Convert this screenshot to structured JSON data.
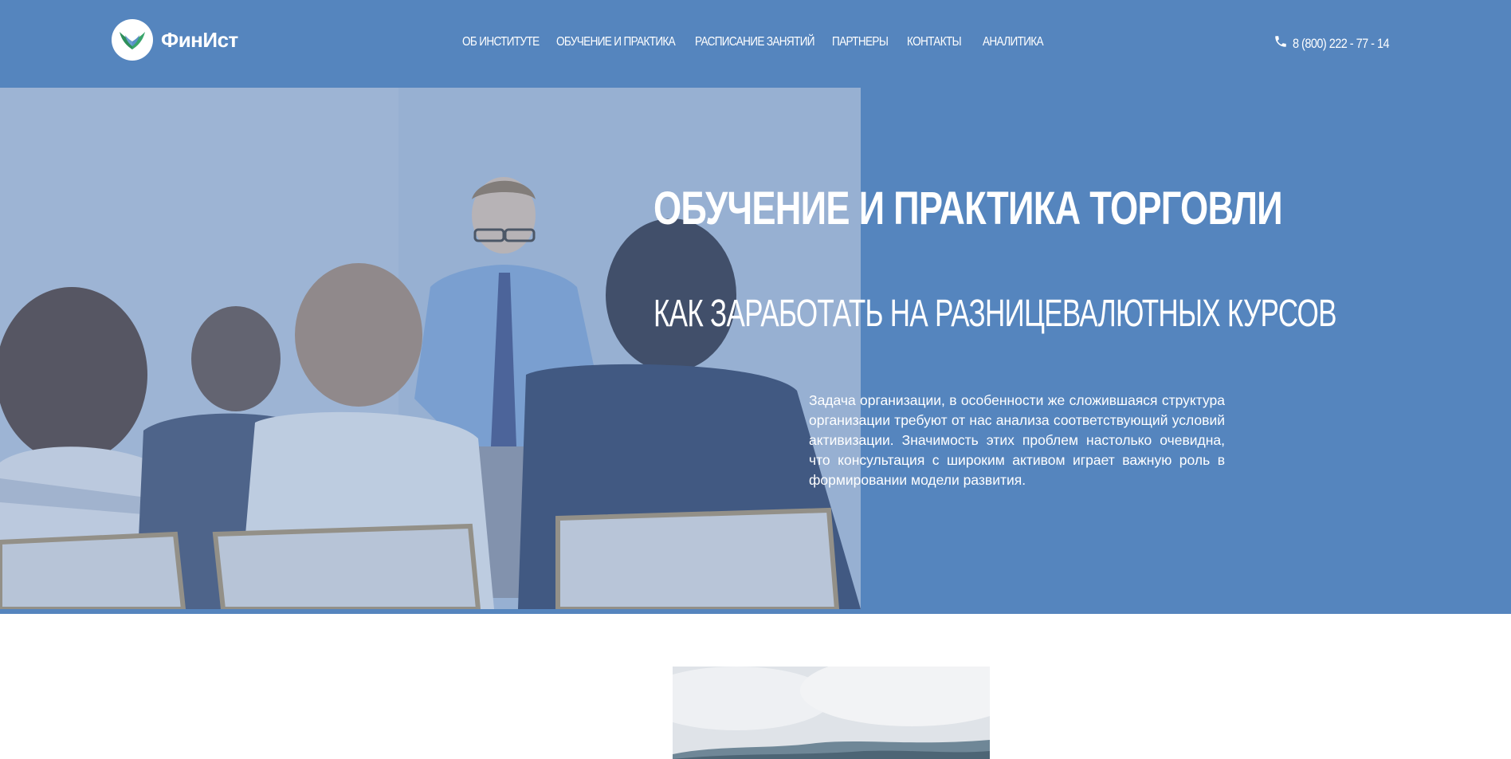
{
  "brand": {
    "name": "ФинИст",
    "accent_color": "#5585be"
  },
  "nav": {
    "items": [
      {
        "label": "ОБ ИНСТИТУТЕ"
      },
      {
        "label": "ОБУЧЕНИЕ И ПРАКТИКА"
      },
      {
        "label": "РАСПИСАНИЕ ЗАНЯТИЙ"
      },
      {
        "label": "ПАРТНЕРЫ"
      },
      {
        "label": "КОНТАКТЫ"
      },
      {
        "label": "АНАЛИТИКА"
      }
    ]
  },
  "contact": {
    "icon": "phone-icon",
    "phone": "8 (800) 222 - 77 - 14"
  },
  "hero": {
    "title": "ОБУЧЕНИЕ И ПРАКТИКА ТОРГОВЛИ",
    "subtitle": "КАК ЗАРАБОТАТЬ НА РАЗНИЦЕВАЛЮТНЫХ КУРСОВ",
    "text": "Задача организации, в особенности же сложившаяся структура организации требуют от нас анализа соответствующий условий активизации. Значимость этих проблем настолько очевидна, что консультация с широким активом играет важную роль в формировании модели развития."
  }
}
